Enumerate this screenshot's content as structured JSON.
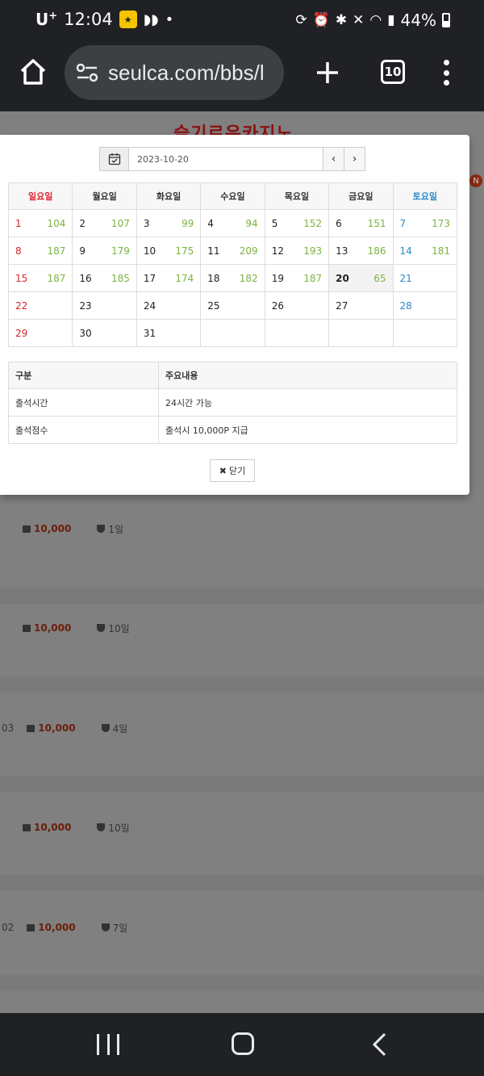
{
  "status_bar": {
    "carrier": "U",
    "carrier_sup": "+",
    "time": "12:04",
    "battery": "44%"
  },
  "browser": {
    "url": "seulca.com/bbs/l",
    "tab_count": "10"
  },
  "background_page": {
    "logo_text": "슬기로운카지노",
    "badge": "N",
    "rows": [
      {
        "prefix": "",
        "point": "10,000",
        "days": "1일"
      },
      {
        "prefix": "",
        "point": "10,000",
        "days": "10일"
      },
      {
        "prefix": "03",
        "point": "10,000",
        "days": "4일"
      },
      {
        "prefix": "",
        "point": "10,000",
        "days": "10일"
      },
      {
        "prefix": "02",
        "point": "10,000",
        "days": "7일"
      }
    ]
  },
  "modal": {
    "date_value": "2023-10-20",
    "prev_label": "‹",
    "next_label": "›",
    "weekdays": [
      "일요일",
      "월요일",
      "화요일",
      "수요일",
      "목요일",
      "금요일",
      "토요일"
    ],
    "weeks": [
      [
        {
          "d": "1",
          "c": "104"
        },
        {
          "d": "2",
          "c": "107"
        },
        {
          "d": "3",
          "c": "99"
        },
        {
          "d": "4",
          "c": "94"
        },
        {
          "d": "5",
          "c": "152"
        },
        {
          "d": "6",
          "c": "151"
        },
        {
          "d": "7",
          "c": "173"
        }
      ],
      [
        {
          "d": "8",
          "c": "187"
        },
        {
          "d": "9",
          "c": "179"
        },
        {
          "d": "10",
          "c": "175"
        },
        {
          "d": "11",
          "c": "209"
        },
        {
          "d": "12",
          "c": "193"
        },
        {
          "d": "13",
          "c": "186"
        },
        {
          "d": "14",
          "c": "181"
        }
      ],
      [
        {
          "d": "15",
          "c": "187"
        },
        {
          "d": "16",
          "c": "185"
        },
        {
          "d": "17",
          "c": "174"
        },
        {
          "d": "18",
          "c": "182"
        },
        {
          "d": "19",
          "c": "187"
        },
        {
          "d": "20",
          "c": "65"
        },
        {
          "d": "21",
          "c": ""
        }
      ],
      [
        {
          "d": "22",
          "c": ""
        },
        {
          "d": "23",
          "c": ""
        },
        {
          "d": "24",
          "c": ""
        },
        {
          "d": "25",
          "c": ""
        },
        {
          "d": "26",
          "c": ""
        },
        {
          "d": "27",
          "c": ""
        },
        {
          "d": "28",
          "c": ""
        }
      ],
      [
        {
          "d": "29",
          "c": ""
        },
        {
          "d": "30",
          "c": ""
        },
        {
          "d": "31",
          "c": ""
        },
        {
          "d": "",
          "c": ""
        },
        {
          "d": "",
          "c": ""
        },
        {
          "d": "",
          "c": ""
        },
        {
          "d": "",
          "c": ""
        }
      ]
    ],
    "today": "20",
    "info_table": {
      "headers": [
        "구분",
        "주요내용"
      ],
      "rows": [
        [
          "출석시간",
          "24시간 가능"
        ],
        [
          "출석점수",
          "출석시 10,000P 지급"
        ]
      ]
    },
    "close_label": "닫기"
  }
}
